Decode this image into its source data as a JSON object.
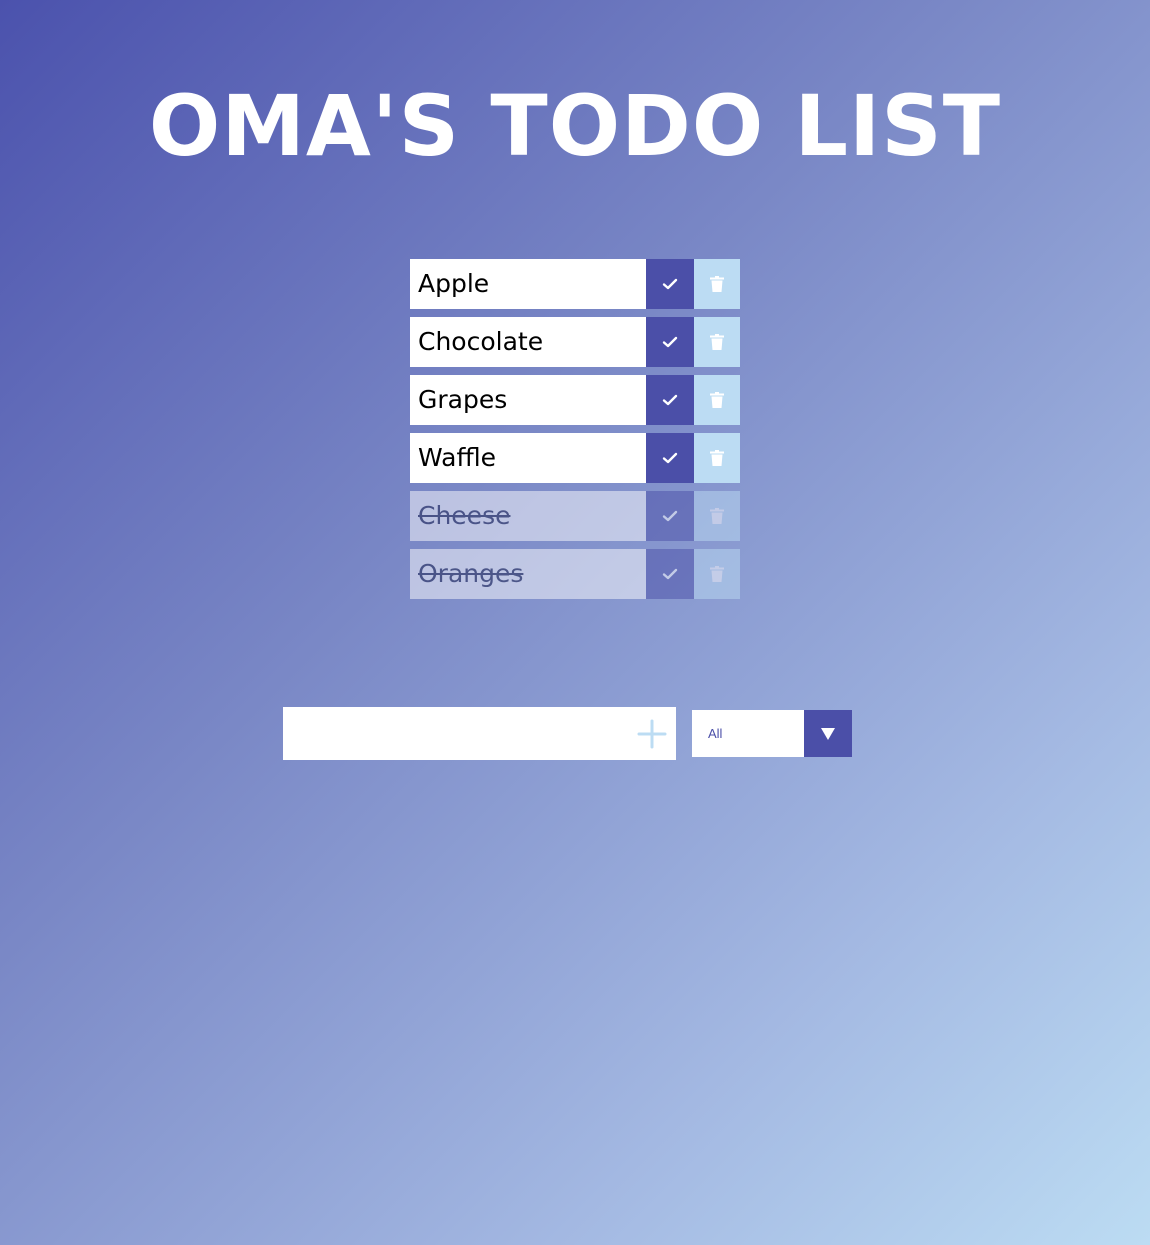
{
  "header": {
    "title": "OMA'S TODO LIST"
  },
  "todos": [
    {
      "text": "Apple",
      "completed": false
    },
    {
      "text": "Chocolate",
      "completed": false
    },
    {
      "text": "Grapes",
      "completed": false
    },
    {
      "text": "Waffle",
      "completed": false
    },
    {
      "text": "Cheese",
      "completed": true
    },
    {
      "text": "Oranges",
      "completed": true
    }
  ],
  "add_form": {
    "input_value": "",
    "button_icon": "plus-icon"
  },
  "filter": {
    "selected": "All",
    "arrow_icon": "caret-down-icon"
  },
  "icons": {
    "complete": "check-icon",
    "delete": "trash-icon"
  },
  "colors": {
    "accent": "#4b4fa8",
    "light_accent": "#bcdcf3",
    "background_start": "#4b52ad",
    "background_end": "#bcdcf3",
    "text_white": "#ffffff"
  }
}
